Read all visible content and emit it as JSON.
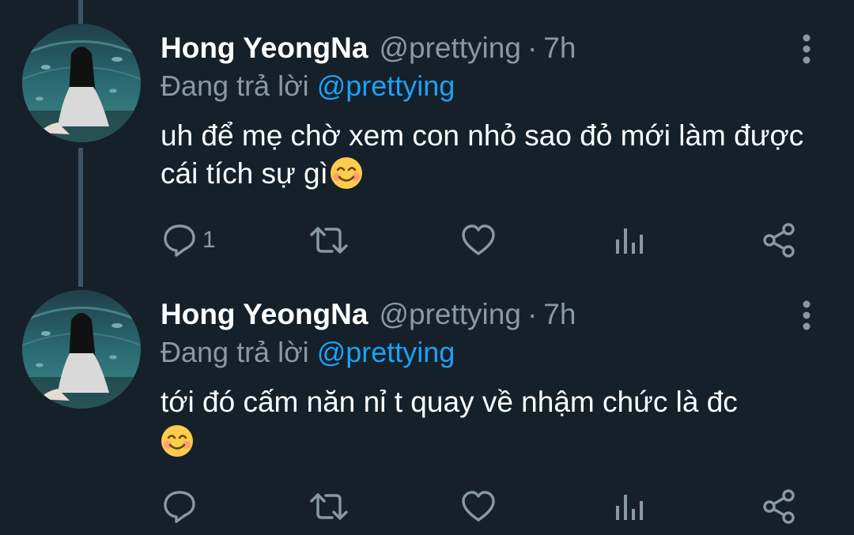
{
  "tweets": [
    {
      "author_name": "Hong YeongNa",
      "author_handle": "@prettying",
      "separator": "·",
      "time": "7h",
      "reply_prefix": "Đang trả lời",
      "reply_to": "@prettying",
      "text": "uh để mẹ chờ xem con nhỏ sao đỏ mới làm được cái tích sự gì",
      "emoji": "smiling-face-with-smiling-eyes",
      "reply_count": "1"
    },
    {
      "author_name": "Hong YeongNa",
      "author_handle": "@prettying",
      "separator": "·",
      "time": "7h",
      "reply_prefix": "Đang trả lời",
      "reply_to": "@prettying",
      "text": "tới đó cấm năn nỉ t quay về nhậm chức là đc",
      "emoji": "smiling-face-with-smiling-eyes",
      "reply_count": ""
    }
  ],
  "icons": {
    "reply": "reply-icon",
    "retweet": "retweet-icon",
    "like": "heart-icon",
    "analytics": "analytics-icon",
    "share": "share-icon",
    "more": "more-vertical-icon"
  },
  "colors": {
    "background": "#15202b",
    "secondary_text": "#8899a6",
    "link": "#1da1f2",
    "thread_line": "#3d5466"
  }
}
